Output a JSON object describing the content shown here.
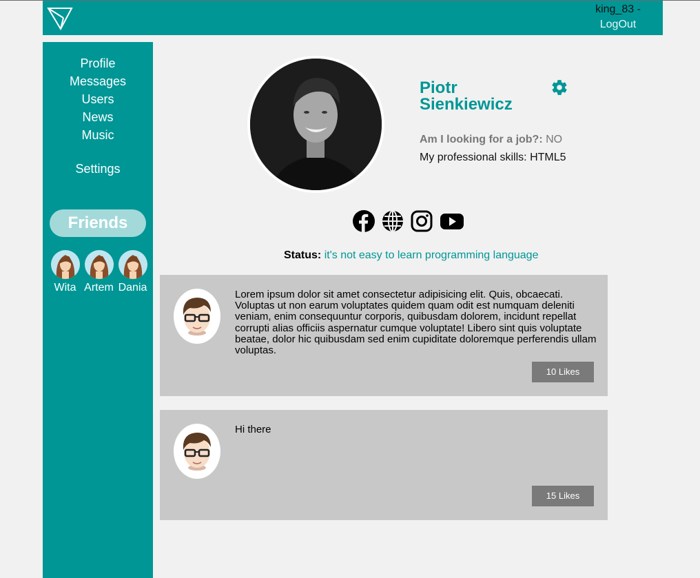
{
  "header": {
    "username": "king_83 -",
    "logout_label": "LogOut"
  },
  "sidebar": {
    "items": [
      {
        "label": "Profile"
      },
      {
        "label": "Messages"
      },
      {
        "label": "Users"
      },
      {
        "label": "News"
      },
      {
        "label": "Music"
      }
    ],
    "settings_label": "Settings",
    "friends_title": "Friends",
    "friends": [
      {
        "name": "Wita"
      },
      {
        "name": "Artem"
      },
      {
        "name": "Dania"
      }
    ]
  },
  "profile": {
    "first_name": "Piotr",
    "last_name": "Sienkiewicz",
    "job_label": "Am I looking for a job?:",
    "job_value": "NO",
    "skills_label": "My professional skills:",
    "skills_value": "HTML5",
    "status_label": "Status:",
    "status_text": "it's not easy to learn programming language",
    "social_icons": [
      "facebook-icon",
      "globe-icon",
      "instagram-icon",
      "youtube-icon"
    ]
  },
  "posts": [
    {
      "text": "Lorem ipsum dolor sit amet consectetur adipisicing elit. Quis, obcaecati. Voluptas ut non earum voluptates quidem quam odit est numquam deleniti veniam, enim consequuntur corporis, quibusdam dolorem, incidunt repellat corrupti alias officiis aspernatur cumque voluptate! Libero sint quis voluptate beatae, dolor hic quibusdam sed enim cupiditate doloremque perferendis ullam voluptas.",
      "likes": "10 Likes"
    },
    {
      "text": "Hi there",
      "likes": "15 Likes"
    }
  ],
  "colors": {
    "accent": "#009696",
    "background": "#f1f1f1",
    "post_bg": "#c8c8c8",
    "likes_bg": "#7a7a7a"
  }
}
